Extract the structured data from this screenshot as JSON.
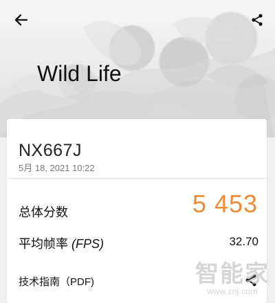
{
  "header": {
    "title": "Wild Life",
    "back_icon": "back-arrow-icon",
    "share_icon": "share-icon"
  },
  "result_card": {
    "device_name": "NX667J",
    "date_time": "5月 18, 2021 10:22",
    "score_label": "总体分数",
    "score_value": "5 453",
    "fps_label_prefix": "平均帧率 ",
    "fps_label_suffix": "(FPS)",
    "fps_value": "32.70",
    "guide_label": "技术指南（PDF)",
    "guide_share_icon": "share-icon"
  },
  "watermark": {
    "text": "智能家",
    "url": "www.znj.com"
  },
  "colors": {
    "score": "#f08b33",
    "text": "#111111",
    "secondary_text": "#777777",
    "card": "#ffffff"
  }
}
